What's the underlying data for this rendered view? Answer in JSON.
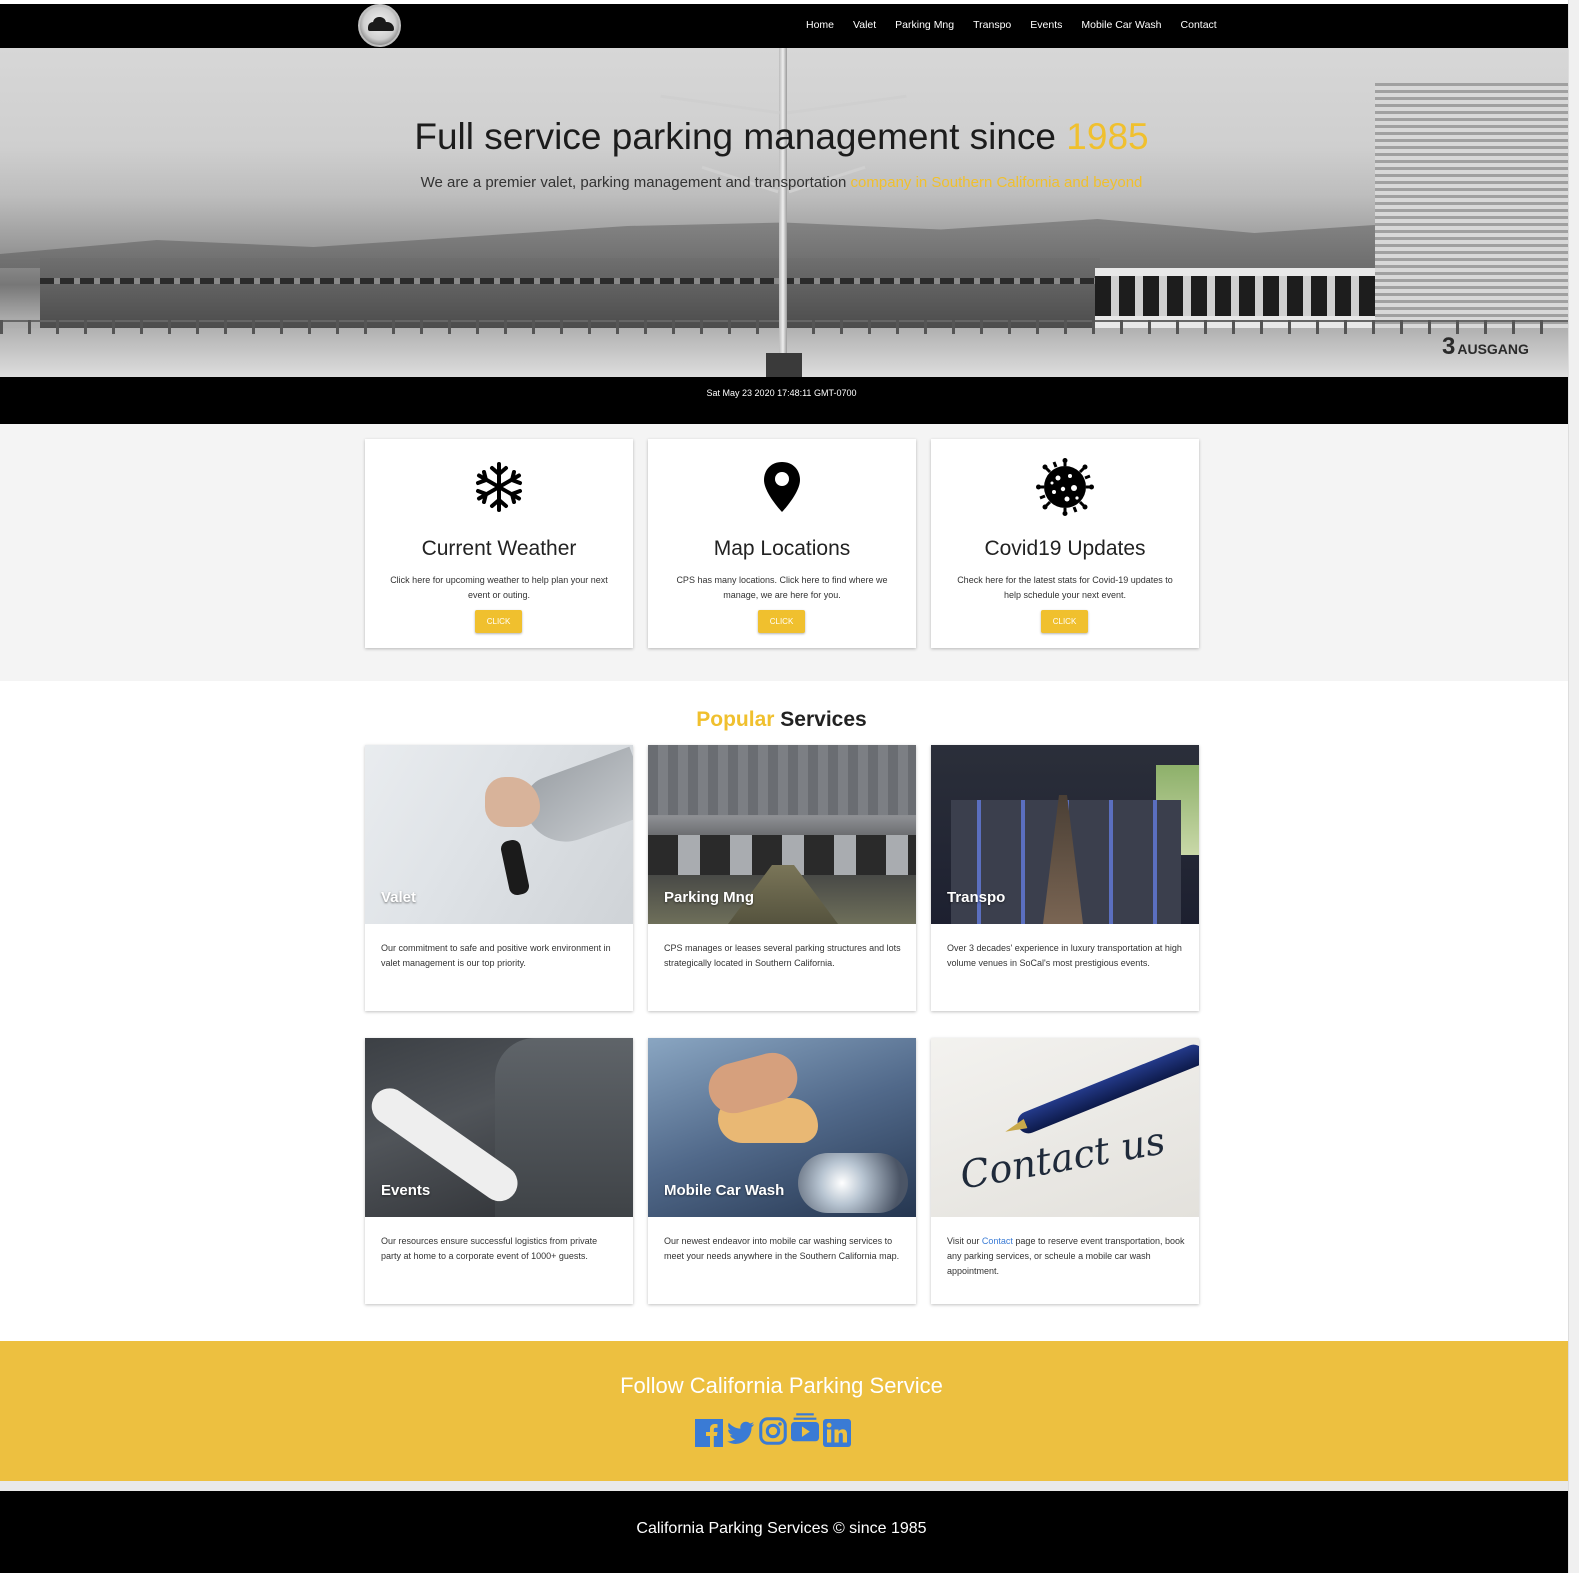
{
  "nav": {
    "items": [
      "Home",
      "Valet",
      "Parking Mng",
      "Transpo",
      "Events",
      "Mobile Car Wash",
      "Contact"
    ]
  },
  "hero": {
    "title_main": "Full service parking management since",
    "title_accent": "1985",
    "subtitle_main": "We are a premier valet, parking management and transportation",
    "subtitle_accent": "company in Southern California and beyond",
    "sign_number": "3",
    "sign_word": "AUSGANG"
  },
  "datebar": {
    "text": "Sat May 23 2020 17:48:11 GMT-0700"
  },
  "info_cards": [
    {
      "icon": "snowflake-icon",
      "title": "Current Weather",
      "text": "Click here for upcoming weather to help plan your next event or outing.",
      "button": "CLICK"
    },
    {
      "icon": "map-pin-icon",
      "title": "Map Locations",
      "text": "CPS has many locations. Click here to find where we manage, we are here for you.",
      "button": "CLICK"
    },
    {
      "icon": "virus-icon",
      "title": "Covid19 Updates",
      "text": "Check here for the latest stats for Covid-19 updates to help schedule your next event.",
      "button": "CLICK"
    }
  ],
  "services": {
    "title_accent": "Popular",
    "title_main": "Services",
    "cards": [
      {
        "title": "Valet",
        "text": "Our commitment to safe and positive work environment in valet management is our top priority."
      },
      {
        "title": "Parking Mng",
        "text": "CPS manages or leases several parking structures and lots strategically located in Southern California."
      },
      {
        "title": "Transpo",
        "text": "Over 3 decades' experience in luxury transportation at high volume venues in SoCal's most prestigious events."
      },
      {
        "title": "Events",
        "text": "Our resources ensure successful logistics from private party at home to a corporate event of 1000+ guests."
      },
      {
        "title": "Mobile Car Wash",
        "text": "Our newest endeavor into mobile car washing services to meet your needs anywhere in the Southern California map."
      },
      {
        "title": "",
        "image_text": "Contact us",
        "text_before": "Visit our",
        "link": "Contact",
        "text_after": "page to reserve event transportation, book any parking services, or scheule a mobile car wash appointment."
      }
    ]
  },
  "follow": {
    "title": "Follow California Parking Service",
    "icons": [
      "facebook-icon",
      "twitter-icon",
      "instagram-icon",
      "youtube-icon",
      "linkedin-icon"
    ],
    "icon_color": "#3a7bd5"
  },
  "footer": {
    "text": "California Parking Services © since 1985"
  },
  "colors": {
    "accent": "#f0c02e",
    "follow_bg": "#edc040",
    "nav_bg": "#000000"
  }
}
